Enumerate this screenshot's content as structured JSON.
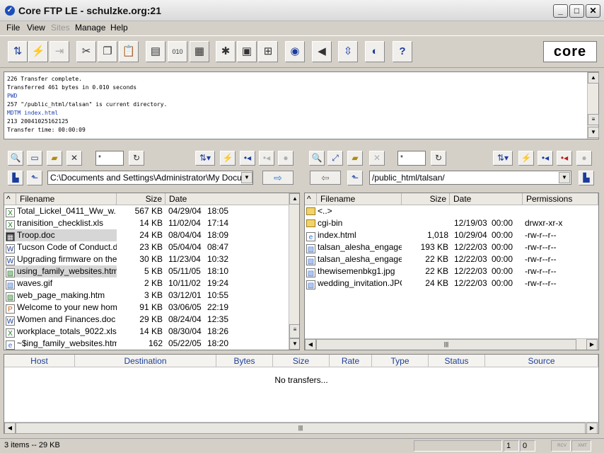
{
  "window": {
    "title": "Core FTP LE - schulzke.org:21"
  },
  "menu": [
    {
      "label": "File",
      "enabled": true
    },
    {
      "label": "View",
      "enabled": true
    },
    {
      "label": "Sites",
      "enabled": false
    },
    {
      "label": "Manage",
      "enabled": true
    },
    {
      "label": "Help",
      "enabled": true
    }
  ],
  "logo_text": "core",
  "log_lines": [
    {
      "text": "226 Transfer complete.",
      "color": "#000000"
    },
    {
      "text": "Transferred 461 bytes in 0.010 seconds",
      "color": "#000000"
    },
    {
      "text": "PWD",
      "color": "#1f3fb0"
    },
    {
      "text": "257 \"/public_html/talsan\" is current directory.",
      "color": "#000000"
    },
    {
      "text": "MDTM index.html",
      "color": "#1f3fb0"
    },
    {
      "text": "213 20041025162125",
      "color": "#000000"
    },
    {
      "text": "Transfer time: 00:00:09",
      "color": "#000000"
    }
  ],
  "local": {
    "filter": "*",
    "path": "C:\\Documents and Settings\\Administrator\\My Document",
    "columns": [
      "Filename",
      "Size",
      "Date"
    ],
    "files": [
      {
        "name": "Total_Lickel_0411_Ww_w...",
        "size": "567 KB",
        "date": "04/29/04",
        "time": "18:05",
        "icon": "xls",
        "selected": false
      },
      {
        "name": "tranisition_checklist.xls",
        "size": "14 KB",
        "date": "11/02/04",
        "time": "17:14",
        "icon": "xls",
        "selected": false
      },
      {
        "name": "Troop.doc",
        "size": "24 KB",
        "date": "08/04/04",
        "time": "18:09",
        "icon": "doc-dark",
        "selected": true
      },
      {
        "name": "Tucson Code of Conduct.d...",
        "size": "23 KB",
        "date": "05/04/04",
        "time": "08:47",
        "icon": "doc",
        "selected": false
      },
      {
        "name": "Upgrading firmware on the ...",
        "size": "30 KB",
        "date": "11/23/04",
        "time": "10:32",
        "icon": "doc",
        "selected": false
      },
      {
        "name": "using_family_websites.htm",
        "size": "5 KB",
        "date": "05/11/05",
        "time": "18:10",
        "icon": "htm",
        "selected": true
      },
      {
        "name": "waves.gif",
        "size": "2 KB",
        "date": "10/11/02",
        "time": "19:24",
        "icon": "img",
        "selected": false
      },
      {
        "name": "web_page_making.htm",
        "size": "3 KB",
        "date": "03/12/01",
        "time": "10:55",
        "icon": "htm",
        "selected": false
      },
      {
        "name": "Welcome to your new hom...",
        "size": "91 KB",
        "date": "03/06/05",
        "time": "22:19",
        "icon": "pub",
        "selected": false
      },
      {
        "name": "Women and Finances.doc",
        "size": "29 KB",
        "date": "08/24/04",
        "time": "12:35",
        "icon": "doc",
        "selected": false
      },
      {
        "name": "workplace_totals_9022.xls",
        "size": "14 KB",
        "date": "08/30/04",
        "time": "18:26",
        "icon": "xls",
        "selected": false
      },
      {
        "name": "~$ing_family_websites.htm",
        "size": "162",
        "date": "05/22/05",
        "time": "18:20",
        "icon": "ie",
        "selected": false
      }
    ]
  },
  "remote": {
    "filter": "*",
    "path": "/public_html/talsan/",
    "columns": [
      "Filename",
      "Size",
      "Date",
      "Permissions"
    ],
    "files": [
      {
        "name": "<..>",
        "size": "",
        "date": "",
        "time": "",
        "perms": "",
        "icon": "folder"
      },
      {
        "name": "cgi-bin",
        "size": "",
        "date": "12/19/03",
        "time": "00:00",
        "perms": "drwxr-xr-x",
        "icon": "folder"
      },
      {
        "name": "index.html",
        "size": "1,018",
        "date": "10/29/04",
        "time": "00:00",
        "perms": "-rw-r--r--",
        "icon": "ie"
      },
      {
        "name": "talsan_alesha_engage...",
        "size": "193 KB",
        "date": "12/22/03",
        "time": "00:00",
        "perms": "-rw-r--r--",
        "icon": "img"
      },
      {
        "name": "talsan_alesha_engage...",
        "size": "22 KB",
        "date": "12/22/03",
        "time": "00:00",
        "perms": "-rw-r--r--",
        "icon": "img"
      },
      {
        "name": "thewisemenbkg1.jpg",
        "size": "22 KB",
        "date": "12/22/03",
        "time": "00:00",
        "perms": "-rw-r--r--",
        "icon": "img"
      },
      {
        "name": "wedding_invitation.JPG",
        "size": "24 KB",
        "date": "12/22/03",
        "time": "00:00",
        "perms": "-rw-r--r--",
        "icon": "img"
      }
    ]
  },
  "transfers": {
    "columns": [
      "Host",
      "Destination",
      "Bytes",
      "Size",
      "Rate",
      "Type",
      "Status",
      "Source"
    ],
    "empty_text": "No transfers..."
  },
  "status": {
    "left": "3 items -- 29 KB",
    "num1": "1",
    "num2": "0",
    "rcv": "RCV",
    "xmt": "XMT"
  }
}
